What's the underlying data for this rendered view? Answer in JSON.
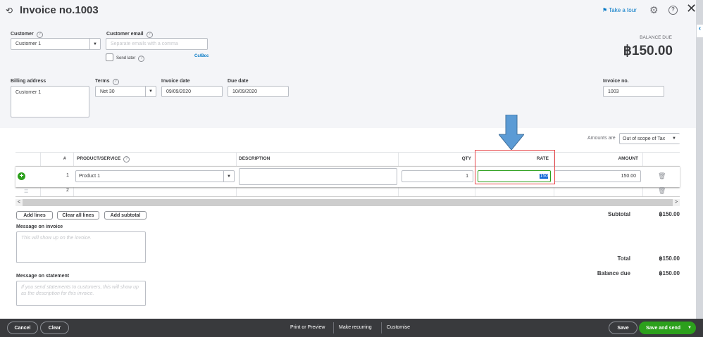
{
  "header": {
    "title": "Invoice no.1003",
    "take_tour": "Take a tour"
  },
  "form": {
    "customer_label": "Customer",
    "customer_value": "Customer 1",
    "email_label": "Customer email",
    "email_placeholder": "Separate emails with a comma",
    "send_later": "Send later",
    "cc_bcc": "Cc/Bcc",
    "balance_due_label": "BALANCE DUE",
    "balance_due_value": "฿150.00",
    "billing_label": "Billing address",
    "billing_value": "Customer 1",
    "terms_label": "Terms",
    "terms_value": "Net 30",
    "invoice_date_label": "Invoice date",
    "invoice_date_value": "09/09/2020",
    "due_date_label": "Due date",
    "due_date_value": "10/09/2020",
    "invoice_no_label": "Invoice no.",
    "invoice_no_value": "1003",
    "amounts_are_label": "Amounts are",
    "amounts_are_value": "Out of scope of Tax"
  },
  "table": {
    "headers": {
      "num": "#",
      "product": "PRODUCT/SERVICE",
      "description": "DESCRIPTION",
      "qty": "QTY",
      "rate": "RATE",
      "amount": "AMOUNT"
    },
    "rows": [
      {
        "num": "1",
        "product": "Product 1",
        "description": "",
        "qty": "1",
        "rate": "150",
        "amount": "150.00"
      },
      {
        "num": "2"
      }
    ]
  },
  "buttons": {
    "add_lines": "Add lines",
    "clear_all": "Clear all lines",
    "add_subtotal": "Add subtotal"
  },
  "messages": {
    "invoice_label": "Message on invoice",
    "invoice_placeholder": "This will show up on the invoice.",
    "statement_label": "Message on statement",
    "statement_placeholder": "If you send statements to customers, this will show up as the description for this invoice."
  },
  "totals": {
    "subtotal_label": "Subtotal",
    "subtotal": "฿150.00",
    "total_label": "Total",
    "total": "฿150.00",
    "balance_label": "Balance due",
    "balance": "฿150.00"
  },
  "footer": {
    "cancel": "Cancel",
    "clear": "Clear",
    "print": "Print or Preview",
    "recurring": "Make recurring",
    "customise": "Customise",
    "save": "Save",
    "save_send": "Save and send"
  },
  "colors": {
    "green": "#2ca01c",
    "annotation_red": "#e8474a",
    "arrow_blue": "#5b9bd5",
    "footer": "#393a3d"
  }
}
